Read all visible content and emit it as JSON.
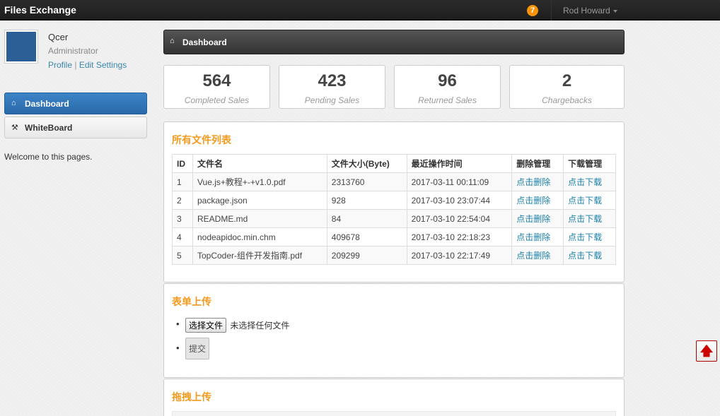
{
  "topbar": {
    "brand": "Files Exchange",
    "notification_count": "7",
    "user_name": "Rod Howard"
  },
  "profile": {
    "name": "Qcer",
    "role": "Administrator",
    "profile_link": "Profile",
    "separator": "|",
    "settings_link": "Edit Settings"
  },
  "sidebar": {
    "items": [
      {
        "label": "Dashboard",
        "icon": "home-icon",
        "active": true
      },
      {
        "label": "WhiteBoard",
        "icon": "wrench-icon",
        "active": false
      }
    ],
    "welcome": "Welcome to this pages."
  },
  "main": {
    "header": "Dashboard",
    "stats": [
      {
        "value": "564",
        "label": "Completed Sales"
      },
      {
        "value": "423",
        "label": "Pending Sales"
      },
      {
        "value": "96",
        "label": "Returned Sales"
      },
      {
        "value": "2",
        "label": "Chargebacks"
      }
    ],
    "files_panel": {
      "title": "所有文件列表",
      "columns": [
        "ID",
        "文件名",
        "文件大小(Byte)",
        "最近操作时间",
        "删除管理",
        "下载管理"
      ],
      "rows": [
        {
          "id": "1",
          "name": "Vue.js+教程+-+v1.0.pdf",
          "size": "2313760",
          "time": "2017-03-11 00:11:09",
          "delete": "点击删除",
          "download": "点击下载"
        },
        {
          "id": "2",
          "name": "package.json",
          "size": "928",
          "time": "2017-03-10 23:07:44",
          "delete": "点击删除",
          "download": "点击下载"
        },
        {
          "id": "3",
          "name": "README.md",
          "size": "84",
          "time": "2017-03-10 22:54:04",
          "delete": "点击删除",
          "download": "点击下载"
        },
        {
          "id": "4",
          "name": "nodeapidoc.min.chm",
          "size": "409678",
          "time": "2017-03-10 22:18:23",
          "delete": "点击删除",
          "download": "点击下载"
        },
        {
          "id": "5",
          "name": "TopCoder-组件开发指南.pdf",
          "size": "209299",
          "time": "2017-03-10 22:17:49",
          "delete": "点击删除",
          "download": "点击下载"
        }
      ]
    },
    "form_upload": {
      "title": "表单上传",
      "choose_file": "选择文件",
      "no_file": "未选择任何文件",
      "submit": "提交"
    },
    "drag_upload": {
      "title": "拖拽上传"
    }
  },
  "scroll_top_icon": "arrow-up-icon",
  "colors": {
    "accent_orange": "#f39a1e",
    "active_nav": "#2a6aa9",
    "link": "#1a7fa8",
    "badge": "#f89406"
  }
}
